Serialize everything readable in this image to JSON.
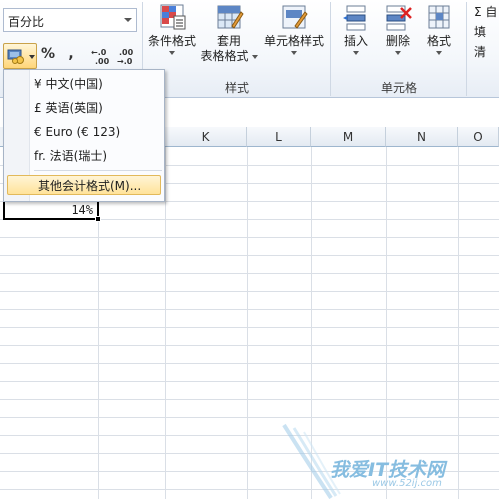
{
  "ribbon": {
    "number_format_value": "百分比",
    "percent_label": "%",
    "comma_label": ",",
    "increase_decimal_label": "+.0 .00",
    "decrease_decimal_label": ".00 →.0",
    "styles": {
      "conditional_format": "条件格式",
      "table_format_line1": "套用",
      "table_format_line2": "表格格式",
      "cell_styles": "单元格样式",
      "group_label": "样式"
    },
    "cells": {
      "insert": "插入",
      "delete": "删除",
      "format": "格式",
      "group_label": "单元格"
    },
    "right_col": [
      "Σ 自",
      "填",
      "清"
    ]
  },
  "menu": {
    "items": [
      "¥ 中文(中国)",
      "£ 英语(英国)",
      "€ Euro (€ 123)",
      "fr. 法语(瑞士)"
    ],
    "more": "其他会计格式(M)..."
  },
  "columns": [
    "K",
    "L",
    "M",
    "N",
    "O"
  ],
  "active_cell_value": "14%",
  "watermark": {
    "text": "我爱IT技术网",
    "url": "www.52ij.com"
  }
}
